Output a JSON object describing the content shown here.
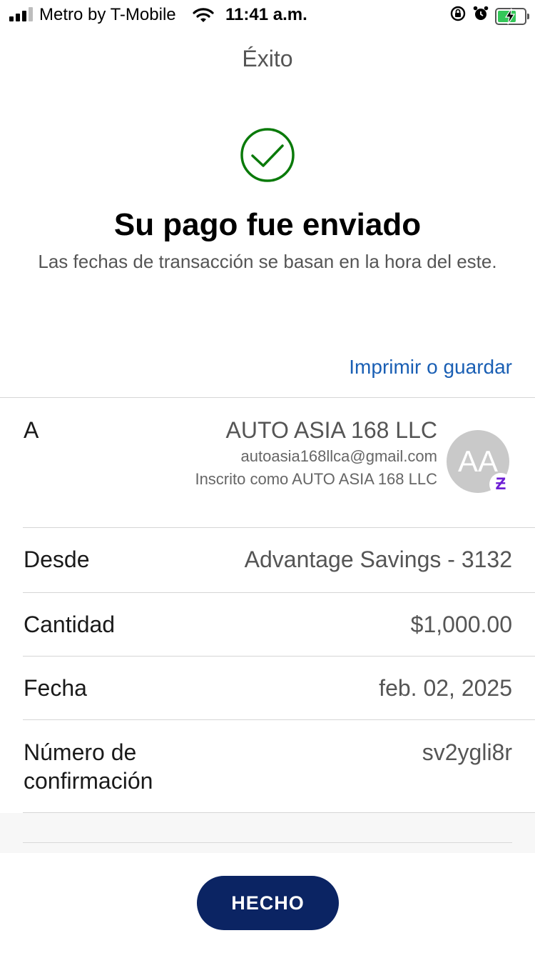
{
  "status_bar": {
    "carrier": "Metro by T-Mobile",
    "time": "11:41 a.m.",
    "icons": [
      "signal-icon",
      "wifi-icon",
      "orientation-lock-icon",
      "alarm-icon",
      "battery-charging-icon"
    ]
  },
  "header": {
    "title": "Éxito"
  },
  "success": {
    "icon": "checkmark-circle-icon",
    "icon_color": "#0a7a0a",
    "headline": "Su pago fue enviado",
    "subtext": "Las fechas de transacción se basan en la hora del este."
  },
  "actions": {
    "print_label": "Imprimir o guardar",
    "link_color": "#1a5fb4"
  },
  "details": {
    "to": {
      "label": "A",
      "name": "AUTO ASIA 168 LLC",
      "email": "autoasia168llca@gmail.com",
      "enrolled": "Inscrito como AUTO ASIA 168 LLC",
      "avatar_initials": "AA",
      "badge": "zelle-icon",
      "badge_glyph": "Ƶ"
    },
    "from": {
      "label": "Desde",
      "value": "Advantage Savings - 3132"
    },
    "amount": {
      "label": "Cantidad",
      "value": "$1,000.00"
    },
    "date": {
      "label": "Fecha",
      "value": "feb. 02, 2025"
    },
    "confirmation": {
      "label_line1": "Número de",
      "label_line2": "confirmación",
      "value": "sv2ygli8r"
    }
  },
  "footer": {
    "done_label": "HECHO",
    "button_color": "#0b2463"
  }
}
